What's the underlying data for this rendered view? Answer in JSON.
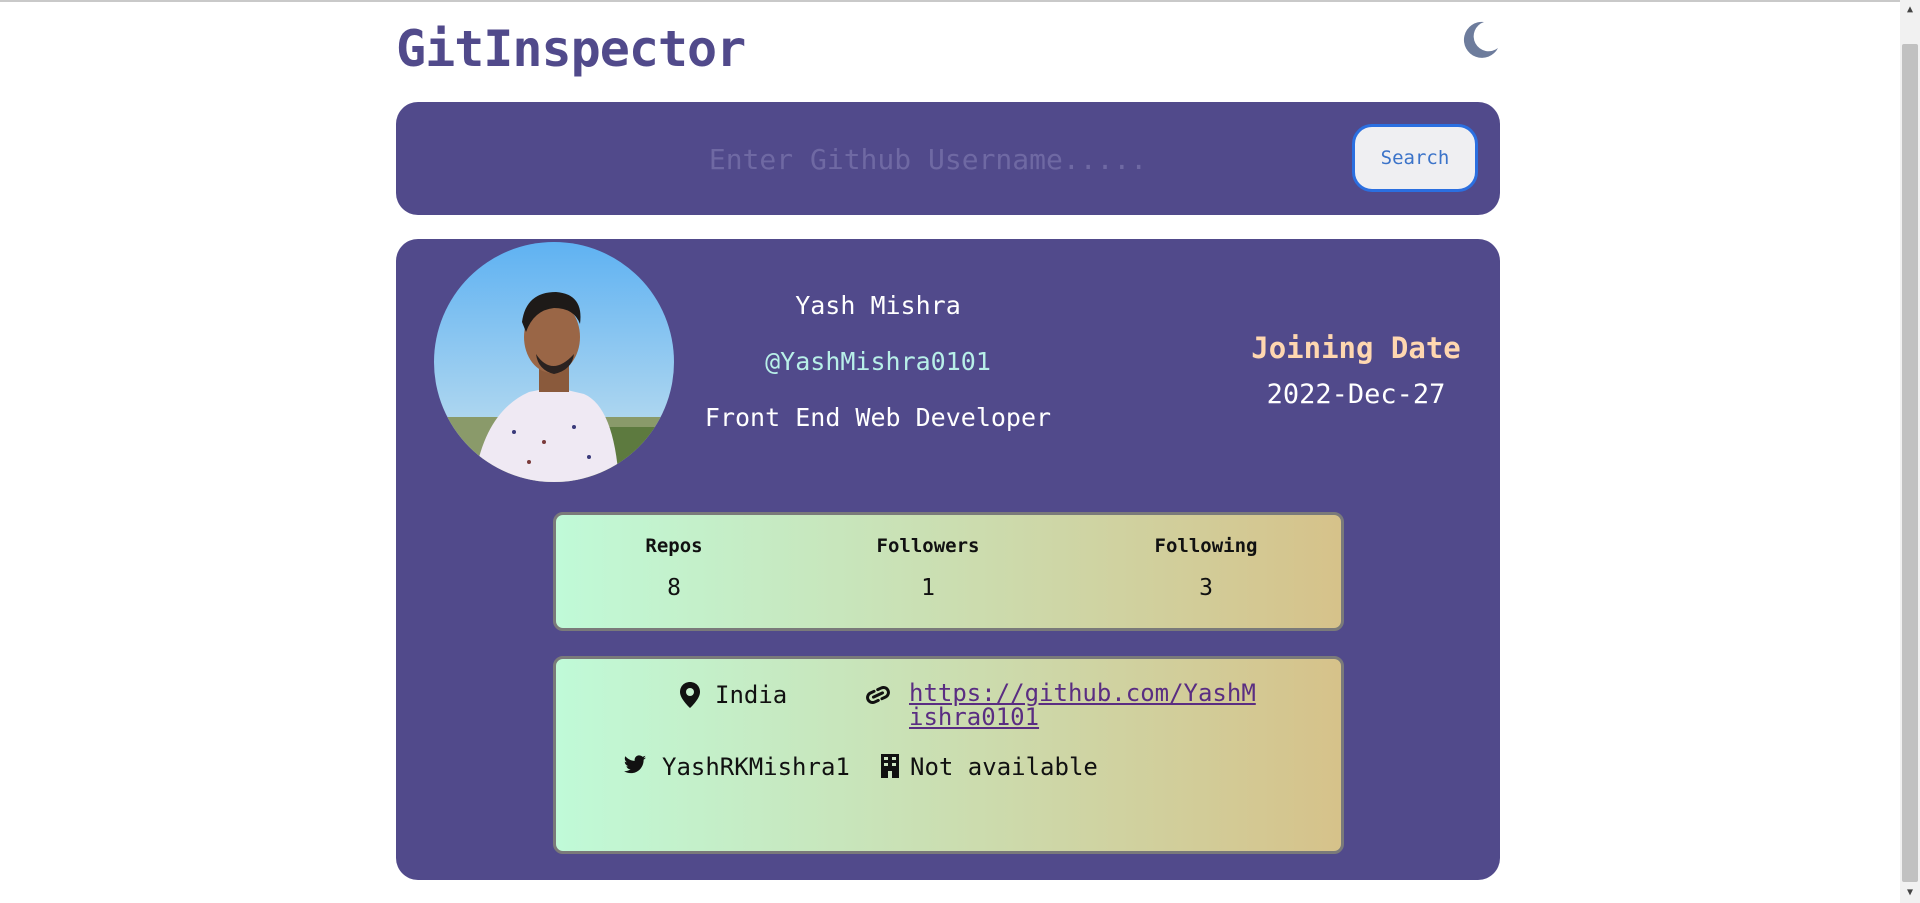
{
  "app": {
    "title": "GitInspector",
    "theme_icon": "moon-icon"
  },
  "search": {
    "placeholder": "Enter Github Username.....",
    "button_label": "Search"
  },
  "profile": {
    "name": "Yash Mishra",
    "login": "@YashMishra0101",
    "bio": "Front End Web Developer",
    "joining_label": "Joining Date",
    "joining_date": "2022-Dec-27",
    "avatar_icon": "avatar-photo"
  },
  "stats": [
    {
      "label": "Repos",
      "value": "8"
    },
    {
      "label": "Followers",
      "value": "1"
    },
    {
      "label": "Following",
      "value": "3"
    }
  ],
  "links": {
    "location": {
      "icon": "location-pin-icon",
      "text": "India"
    },
    "website": {
      "icon": "link-icon",
      "text": "https://github.com/YashMishra0101"
    },
    "twitter": {
      "icon": "twitter-icon",
      "text": "YashRKMishra1"
    },
    "company": {
      "icon": "building-icon",
      "text": "Not available"
    }
  },
  "colors": {
    "brand": "#514a8b",
    "login": "#b8f0e8",
    "joining_label": "#ffd7b0",
    "button_border": "#2b6fe0"
  }
}
